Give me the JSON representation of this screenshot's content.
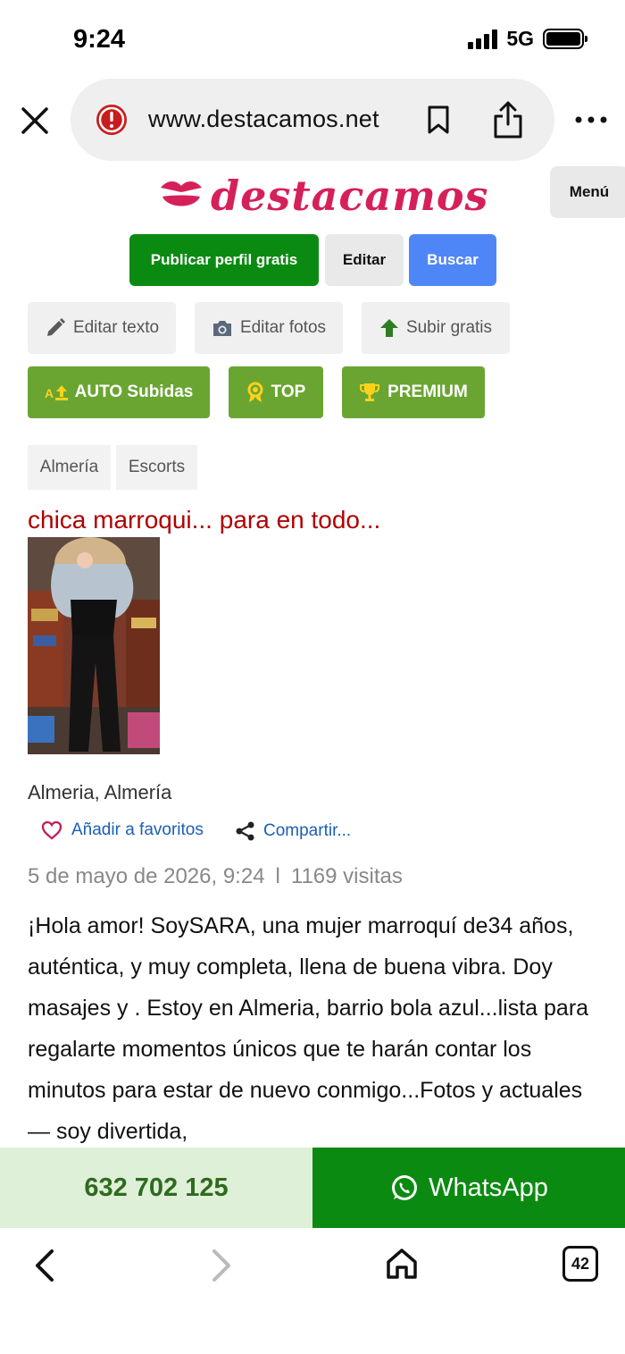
{
  "status_bar": {
    "time": "9:24",
    "network": "5G"
  },
  "browser": {
    "url": "www.destacamos.net",
    "tab_count": "42"
  },
  "site": {
    "logo_text": "destacamos",
    "menu_label": "Menú",
    "brand_color": "#d6205a"
  },
  "actions": {
    "publish": "Publicar perfil gratis",
    "edit": "Editar",
    "search": "Buscar"
  },
  "tools": {
    "edit_text": "Editar texto",
    "edit_photos": "Editar fotos",
    "upload_free": "Subir gratis"
  },
  "promos": {
    "auto": "AUTO Subidas",
    "top": "TOP",
    "premium": "PREMIUM"
  },
  "breadcrumb": [
    "Almería",
    "Escorts"
  ],
  "ad": {
    "title": "chica marroqui... para en todo...",
    "location": "Almeria, Almería",
    "favorite": "Añadir a favoritos",
    "share": "Compartir...",
    "date": "5 de mayo de 2026, 9:24",
    "separator": "l",
    "visits": "1169 visitas",
    "description": "¡Hola amor! SoySARA, una mujer marroquí de34 años, auténtica, y muy completa, llena de buena vibra. Doy masajes y . Estoy en Almeria, barrio bola azul...lista para regalarte momentos únicos que te harán contar los minutos para estar de nuevo conmigo...Fotos y actuales — soy divertida,"
  },
  "contact": {
    "phone": "632 702 125",
    "whatsapp": "WhatsApp"
  }
}
